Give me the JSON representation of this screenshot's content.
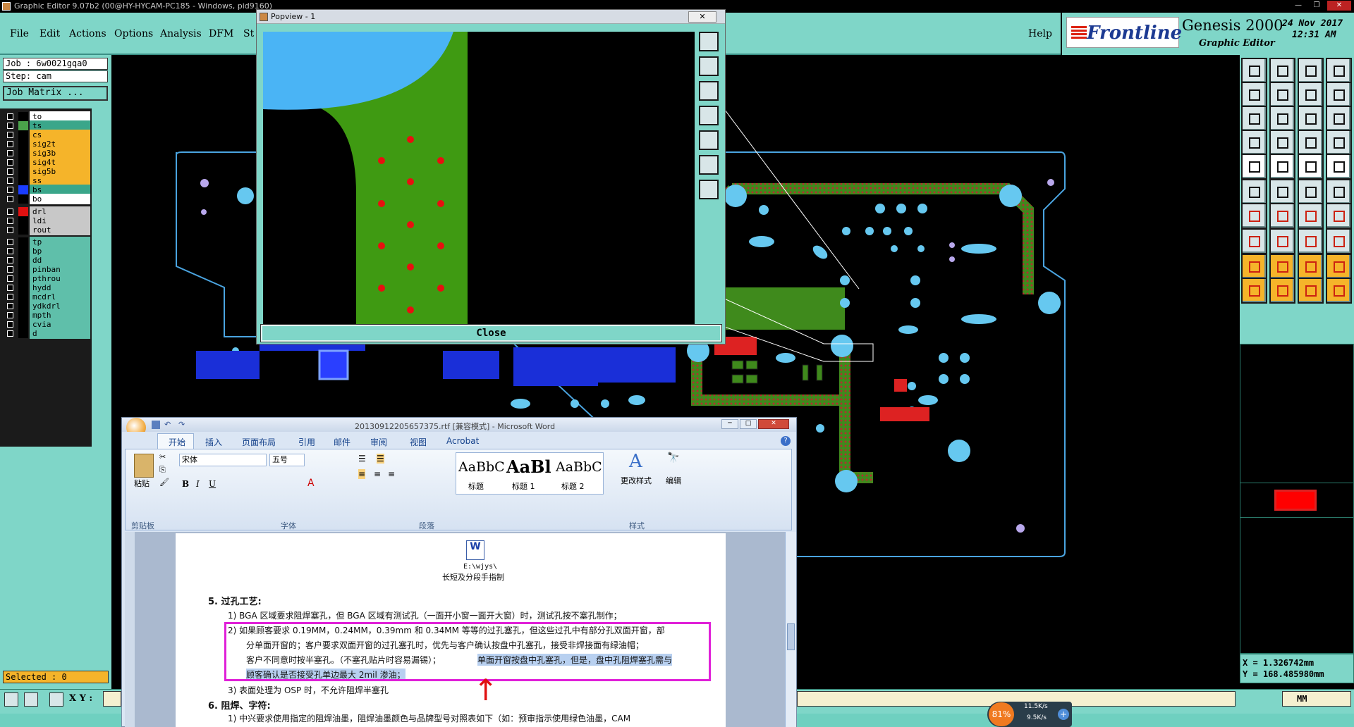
{
  "window": {
    "title": "Graphic Editor 9.07b2 (00@HY-HYCAM-PC185 - Windows, pid9160)"
  },
  "menu": {
    "items": [
      "File",
      "Edit",
      "Actions",
      "Options",
      "Analysis",
      "DFM",
      "St"
    ],
    "help": "Help"
  },
  "brand": {
    "logo": "Frontline",
    "product": "Genesis 2000",
    "subtitle": "Graphic Editor",
    "date": "24 Nov 2017",
    "time": "12:31 AM"
  },
  "job": {
    "job_label": "Job : 6w0021gqa0",
    "step_label": "Step: cam",
    "matrix_button": "Job Matrix ..."
  },
  "layers": [
    {
      "name": "to",
      "color": "#000000",
      "bg": "#ffffff"
    },
    {
      "name": "ts",
      "color": "#4aa34a",
      "bg": "#3aa68a"
    },
    {
      "name": "cs",
      "color": "#000000",
      "bg": "#f5b42a"
    },
    {
      "name": "sig2t",
      "color": "#000000",
      "bg": "#f5b42a"
    },
    {
      "name": "sig3b",
      "color": "#000000",
      "bg": "#f5b42a"
    },
    {
      "name": "sig4t",
      "color": "#000000",
      "bg": "#f5b42a"
    },
    {
      "name": "sig5b",
      "color": "#000000",
      "bg": "#f5b42a"
    },
    {
      "name": "ss",
      "color": "#000000",
      "bg": "#f5b42a"
    },
    {
      "name": "bs",
      "color": "#1a3cff",
      "bg": "#3aa68a"
    },
    {
      "name": "bo",
      "color": "#000000",
      "bg": "#ffffff"
    },
    {
      "name": "drl",
      "color": "#e01010",
      "bg": "#c8c8c8"
    },
    {
      "name": "ldi",
      "color": "#000000",
      "bg": "#c8c8c8"
    },
    {
      "name": "rout",
      "color": "#000000",
      "bg": "#c8c8c8"
    },
    {
      "name": "tp",
      "color": "#000000",
      "bg": "#5fbfaa"
    },
    {
      "name": "bp",
      "color": "#000000",
      "bg": "#5fbfaa"
    },
    {
      "name": "dd",
      "color": "#000000",
      "bg": "#5fbfaa"
    },
    {
      "name": "pinban",
      "color": "#000000",
      "bg": "#5fbfaa"
    },
    {
      "name": "pthrou",
      "color": "#000000",
      "bg": "#5fbfaa"
    },
    {
      "name": "hydd",
      "color": "#000000",
      "bg": "#5fbfaa"
    },
    {
      "name": "mcdrl",
      "color": "#000000",
      "bg": "#5fbfaa"
    },
    {
      "name": "ydkdrl",
      "color": "#000000",
      "bg": "#5fbfaa"
    },
    {
      "name": "mpth",
      "color": "#000000",
      "bg": "#5fbfaa"
    },
    {
      "name": "cvia",
      "color": "#000000",
      "bg": "#5fbfaa"
    },
    {
      "name": "d",
      "color": "#000000",
      "bg": "#5fbfaa"
    }
  ],
  "status": {
    "selected": "Selected : 0",
    "xy_label": "X Y :",
    "x": "X = 1.326742mm",
    "y": "Y = 168.485980mm",
    "units": "MM"
  },
  "popview": {
    "title": "Popview - 1",
    "close_label": "Close"
  },
  "word": {
    "title": "20130912205657375.rtf [兼容模式] - Microsoft Word",
    "tabs": [
      "开始",
      "插入",
      "页面布局",
      "引用",
      "邮件",
      "审阅",
      "视图",
      "Acrobat"
    ],
    "font_name": "宋体",
    "font_size": "五号",
    "paste": "粘贴",
    "group_clipboard": "剪贴板",
    "group_font": "字体",
    "group_paragraph": "段落",
    "group_styles": "样式",
    "styles": [
      {
        "preview": "AaBbC",
        "name": "标题"
      },
      {
        "preview": "AaBl",
        "name": "标题 1"
      },
      {
        "preview": "AaBbC",
        "name": "标题 2"
      }
    ],
    "change_styles": "更改样式",
    "edit": "编辑",
    "embed_path": "E:\\wjys\\",
    "embed_caption": "长短及分段手指制",
    "doc": {
      "h5": "5.  过孔工艺:",
      "l1": "1)  BGA 区域要求阻焊塞孔，但 BGA 区域有测试孔（一面开小窗一面开大窗）时，测试孔按不塞孔制作；",
      "l2a": "2)  如果顾客要求 0.19MM，0.24MM，0.39mm 和 0.34MM 等等的过孔塞孔，但这些过孔中有部分孔双面开窗，部",
      "l2b": "分单面开窗的；客户要求双面开窗的过孔塞孔时，优先与客户确认按盘中孔塞孔，接受非焊接面有绿油帽；",
      "l2c": "客户不同意时按半塞孔。（不塞孔贴片时容易漏锡）；",
      "l2c_hl": "单面开窗按盘中孔塞孔，但是，盘中孔阻焊塞孔需与",
      "l2d_hl": "顾客确认是否接受孔单边最大 2mil 渗油；",
      "l3": "3)  表面处理为 OSP 时，不允许阻焊半塞孔",
      "h6": "6.  阻焊、字符:",
      "l6_1": "1) 中兴要求使用指定的阻焊油墨，阻焊油墨颜色与品牌型号对照表如下（如：预审指示使用绿色油墨，CAM"
    }
  },
  "network": {
    "percent": "81%",
    "up": "11.5K/s",
    "down": "9.5K/s"
  }
}
